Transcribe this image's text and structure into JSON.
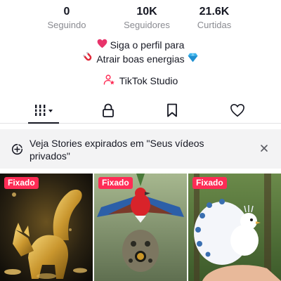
{
  "profile": {
    "stats": [
      {
        "value": "0",
        "label": "Seguindo"
      },
      {
        "value": "10K",
        "label": "Seguidores"
      },
      {
        "value": "21.6K",
        "label": "Curtidas"
      }
    ],
    "bio": {
      "line1": "Siga o perfil para",
      "line2": "Atrair boas energias",
      "line1_icon": "heart-icon",
      "line2_icon_left": "magnet-icon",
      "line2_icon_right": "gem-icon"
    },
    "studio_link": {
      "label": "TikTok Studio",
      "icon": "user-star-icon"
    }
  },
  "tabs": [
    {
      "name": "videos-grid",
      "icon": "grid-icon",
      "selected": true
    },
    {
      "name": "private",
      "icon": "lock-icon",
      "selected": false
    },
    {
      "name": "saved",
      "icon": "bookmark-icon",
      "selected": false
    },
    {
      "name": "liked",
      "icon": "heart-outline-icon",
      "selected": false
    }
  ],
  "banner": {
    "text": "Veja Stories expirados em \"Seus vídeos privados\"",
    "icon": "plus-circle-icon",
    "close_icon": "close-icon"
  },
  "videos": [
    {
      "badge": "Fixado",
      "subject": "golden fox"
    },
    {
      "badge": "Fixado",
      "subject": "colorful bird"
    },
    {
      "badge": "Fixado",
      "subject": "white peacock"
    }
  ],
  "colors": {
    "accent": "#fe2c55",
    "text": "#161823",
    "muted": "#8a8b91",
    "banner_bg": "#f3f3f4"
  }
}
